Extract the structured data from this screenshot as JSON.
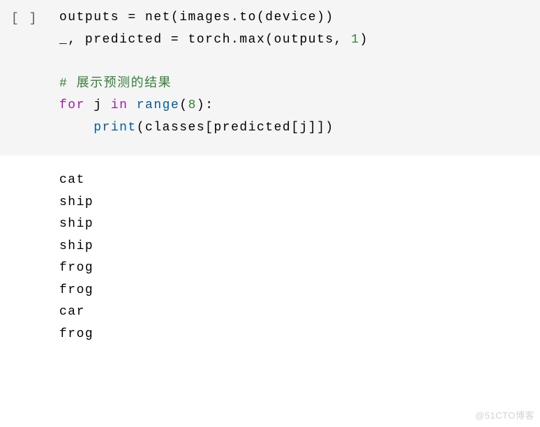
{
  "cell": {
    "gutter": "[ ]",
    "code": {
      "line1": {
        "t1": "outputs = net",
        "p1": "(",
        "t2": "images.to",
        "p2": "(",
        "t3": "device",
        "p3": "))"
      },
      "line2": {
        "t1": "_, predicted = torch.max",
        "p1": "(",
        "t2": "outputs, ",
        "n1": "1",
        "p2": ")"
      },
      "line4_comment": "# 展示预测的结果",
      "line5": {
        "k1": "for",
        "t1": " j ",
        "k2": "in",
        "t2": " ",
        "b1": "range",
        "p1": "(",
        "n1": "8",
        "p2": ")",
        "t3": ":"
      },
      "line6": {
        "b1": "print",
        "p1": "(",
        "t1": "classes",
        "p2": "[",
        "t2": "predicted",
        "p3": "[",
        "t3": "j",
        "p4": "]])"
      }
    }
  },
  "output": {
    "lines": "cat\nship\nship\nship\nfrog\nfrog\ncar\nfrog"
  },
  "watermark": "@51CTO博客"
}
